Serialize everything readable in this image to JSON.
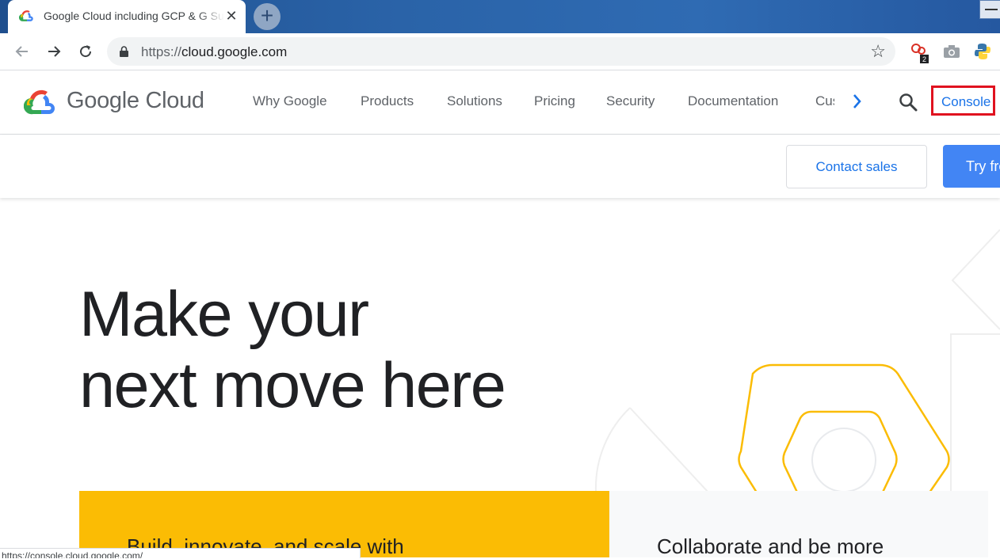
{
  "browser": {
    "tab_title": "Google Cloud including GCP & G Suite",
    "tab_close": "✕",
    "new_tab": "+",
    "url_scheme": "https://",
    "url_host": "cloud.google.com",
    "bookmark_icon": "☆",
    "extension_badge": "2",
    "status_url": "https://console.cloud.google.com/"
  },
  "header": {
    "logo_text": "Google Cloud",
    "nav": [
      "Why Google",
      "Products",
      "Solutions",
      "Pricing",
      "Security",
      "Documentation",
      "Customers"
    ],
    "console_label": "Console"
  },
  "subheader": {
    "contact_label": "Contact sales",
    "try_label": "Try free"
  },
  "hero": {
    "title_line1": "Make your",
    "title_line2": "next move here"
  },
  "cards": {
    "left_heading": "Build, innovate, and scale with",
    "right_heading": "Collaborate and be more"
  },
  "colors": {
    "brand_blue": "#4285f4",
    "link_blue": "#1a73e8",
    "yellow": "#fbbc04",
    "highlight_red": "#e0121f"
  }
}
